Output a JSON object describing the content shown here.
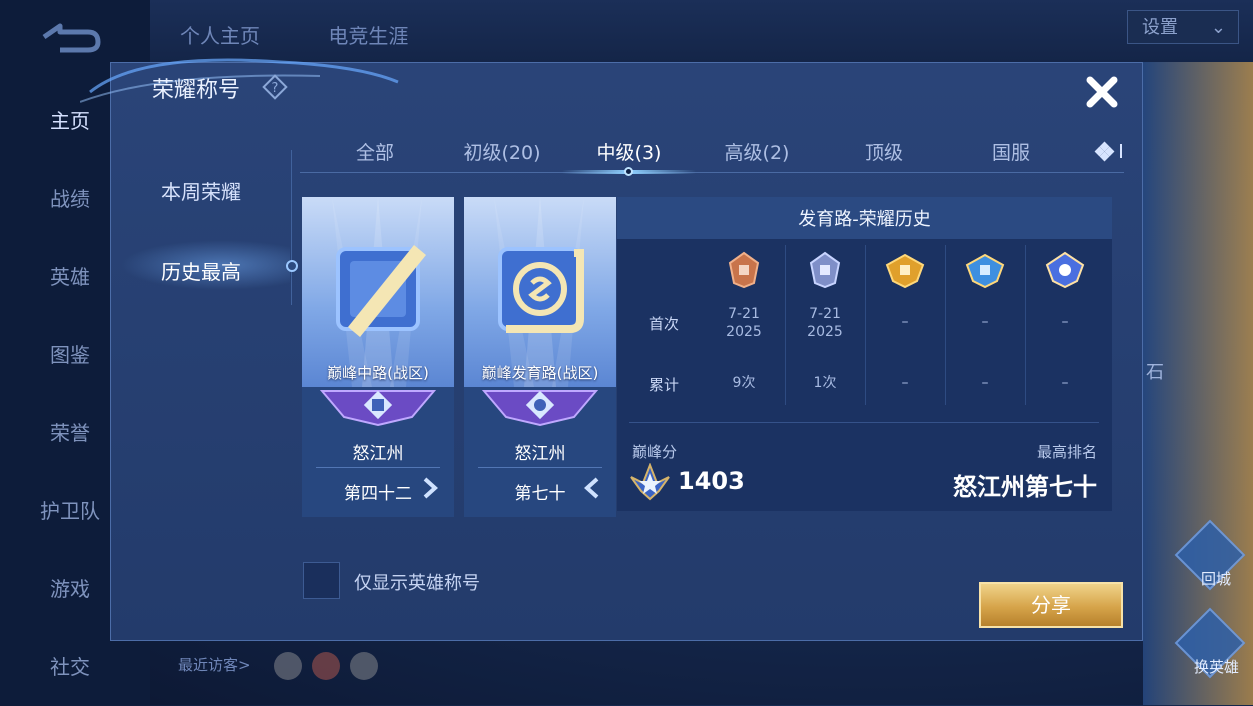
{
  "background": {
    "top_tabs": [
      "个人主页",
      "电竞生涯"
    ],
    "side_nav": [
      "主页",
      "战绩",
      "英雄",
      "图鉴",
      "荣誉",
      "护卫队",
      "游戏",
      "社交"
    ],
    "settings_label": "设置",
    "visitors_label": "最近访客>",
    "right_actions": [
      "回城",
      "换英雄"
    ],
    "partial_text": "石"
  },
  "dialog": {
    "title": "荣耀称号",
    "left_menu": [
      "本周荣耀",
      "历史最高"
    ],
    "left_menu_active": "历史最高",
    "tabs": [
      "全部",
      "初级(20)",
      "中级(3)",
      "高级(2)",
      "顶级",
      "国服"
    ],
    "active_tab": "中级(3)",
    "cards": [
      {
        "name": "巅峰中路(战区)",
        "region": "怒江州",
        "rank": "第四十二"
      },
      {
        "name": "巅峰发育路(战区)",
        "region": "怒江州",
        "rank": "第七十"
      }
    ],
    "history": {
      "title": "发育路-荣耀历史",
      "row_first": "首次",
      "row_total": "累计",
      "first": [
        "7-21\n2025",
        "7-21\n2025",
        "–",
        "–",
        "–"
      ],
      "total": [
        "9次",
        "1次",
        "–",
        "–",
        "–"
      ],
      "peak_label": "巅峰分",
      "peak_score": "1403",
      "best_label": "最高排名",
      "best_value": "怒江州第七十"
    },
    "checkbox_label": "仅显示英雄称号",
    "share_label": "分享"
  },
  "colors": {
    "dialog_bg": "#233b6b",
    "share_gold": "#d6a44a",
    "tab_highlight": "#8fd0ff"
  },
  "icons": [
    "back-arrow-icon",
    "help-icon",
    "close-icon",
    "more-icon",
    "medal-icon",
    "peak-star-icon",
    "chevron-right-icon",
    "chevron-left-icon"
  ]
}
